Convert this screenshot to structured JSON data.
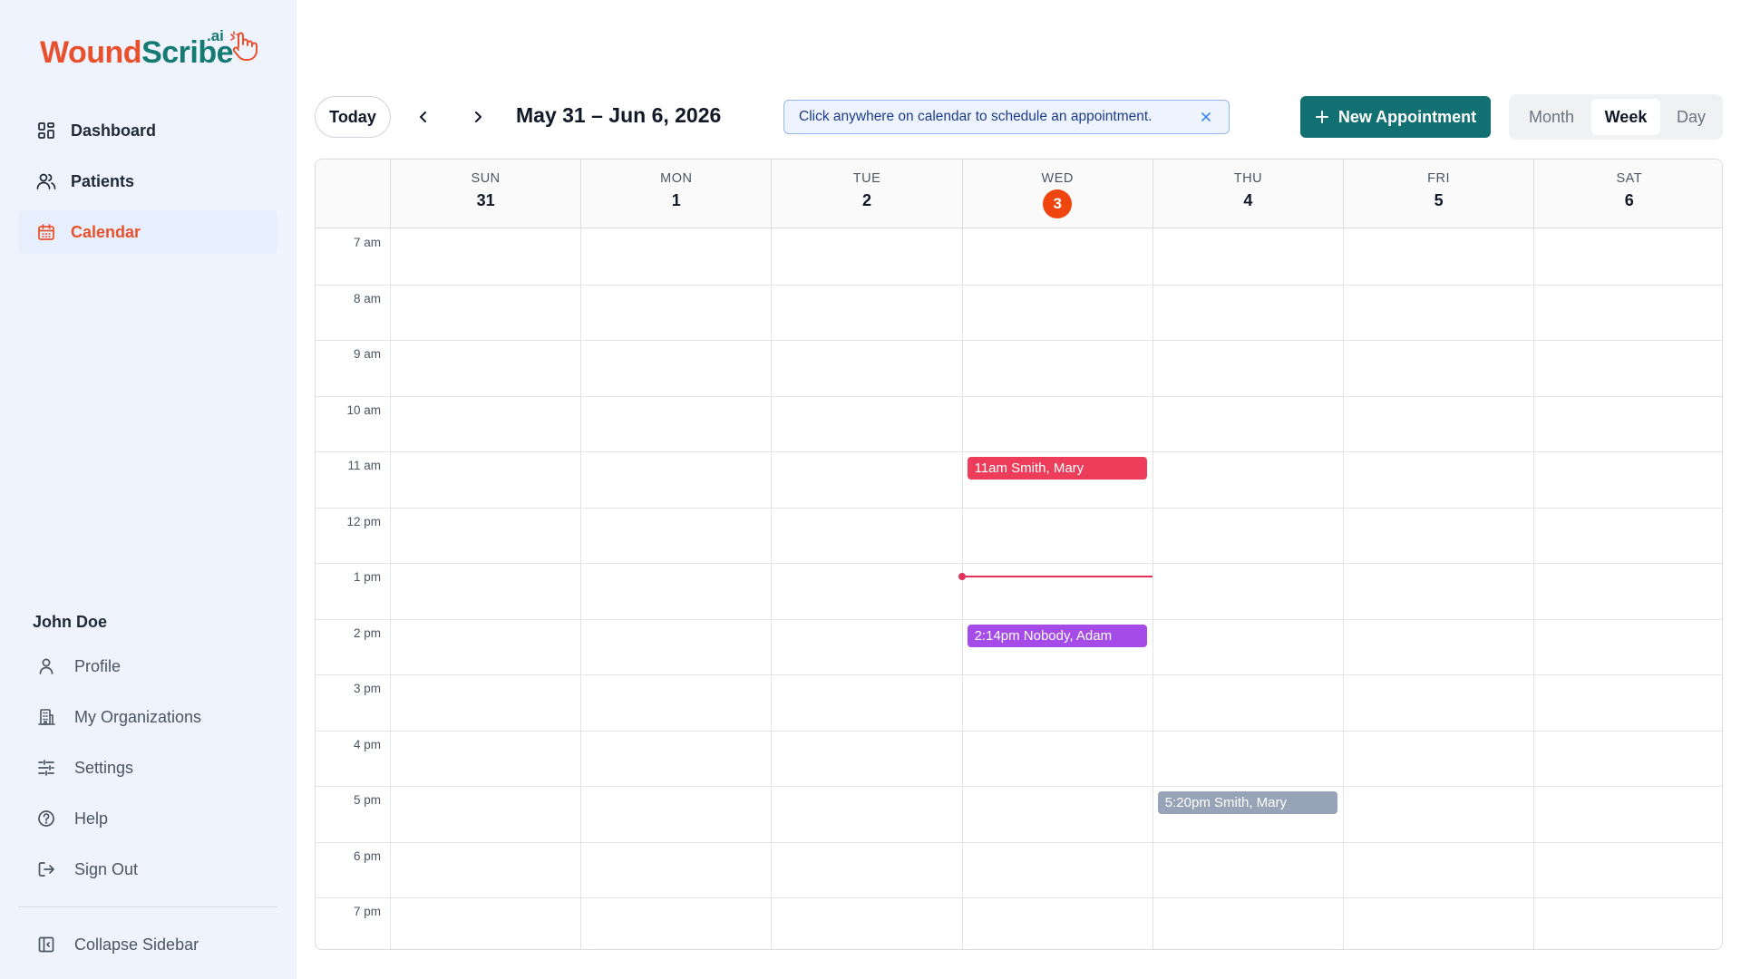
{
  "app": {
    "logo_part1": "Wound",
    "logo_part2": "Scribe",
    "logo_suffix": ".ai",
    "brand_orange": "#e8512e",
    "brand_teal": "#157a74"
  },
  "sidebar": {
    "nav": [
      {
        "label": "Dashboard",
        "icon": "dashboard-icon"
      },
      {
        "label": "Patients",
        "icon": "users-icon"
      },
      {
        "label": "Calendar",
        "icon": "calendar-icon",
        "active": true
      }
    ],
    "user_name": "John Doe",
    "user_menu": [
      {
        "label": "Profile",
        "icon": "user-icon"
      },
      {
        "label": "My Organizations",
        "icon": "building-icon"
      },
      {
        "label": "Settings",
        "icon": "sliders-icon"
      },
      {
        "label": "Help",
        "icon": "help-circle-icon"
      },
      {
        "label": "Sign Out",
        "icon": "sign-out-icon"
      }
    ],
    "collapse_label": "Collapse Sidebar"
  },
  "toolbar": {
    "today_label": "Today",
    "range_label": "May 31 – Jun 6, 2026",
    "hint_text": "Click anywhere on calendar to schedule an appointment.",
    "new_appointment_label": "New Appointment",
    "views": [
      "Month",
      "Week",
      "Day"
    ],
    "active_view": "Week"
  },
  "calendar": {
    "days": [
      {
        "dow": "SUN",
        "num": "31"
      },
      {
        "dow": "MON",
        "num": "1"
      },
      {
        "dow": "TUE",
        "num": "2"
      },
      {
        "dow": "WED",
        "num": "3",
        "today": true
      },
      {
        "dow": "THU",
        "num": "4"
      },
      {
        "dow": "FRI",
        "num": "5"
      },
      {
        "dow": "SAT",
        "num": "6"
      }
    ],
    "hours": [
      "7 am",
      "8 am",
      "9 am",
      "10 am",
      "11 am",
      "12 pm",
      "1 pm",
      "2 pm",
      "3 pm",
      "4 pm",
      "5 pm",
      "6 pm",
      "7 pm"
    ],
    "events": [
      {
        "label": "11am Smith, Mary",
        "day_index": 3,
        "hour_index": 4,
        "color": "#ee3d5a"
      },
      {
        "label": "2:14pm Nobody, Adam",
        "day_index": 3,
        "hour_index": 7,
        "color": "#a54be8"
      },
      {
        "label": "5:20pm Smith, Mary",
        "day_index": 4,
        "hour_index": 10,
        "color": "#97a3b6"
      }
    ],
    "current_time": {
      "day_index": 3,
      "hour_offset": 6.25,
      "color": "#e0325a"
    },
    "today_color": "#f0450f"
  }
}
